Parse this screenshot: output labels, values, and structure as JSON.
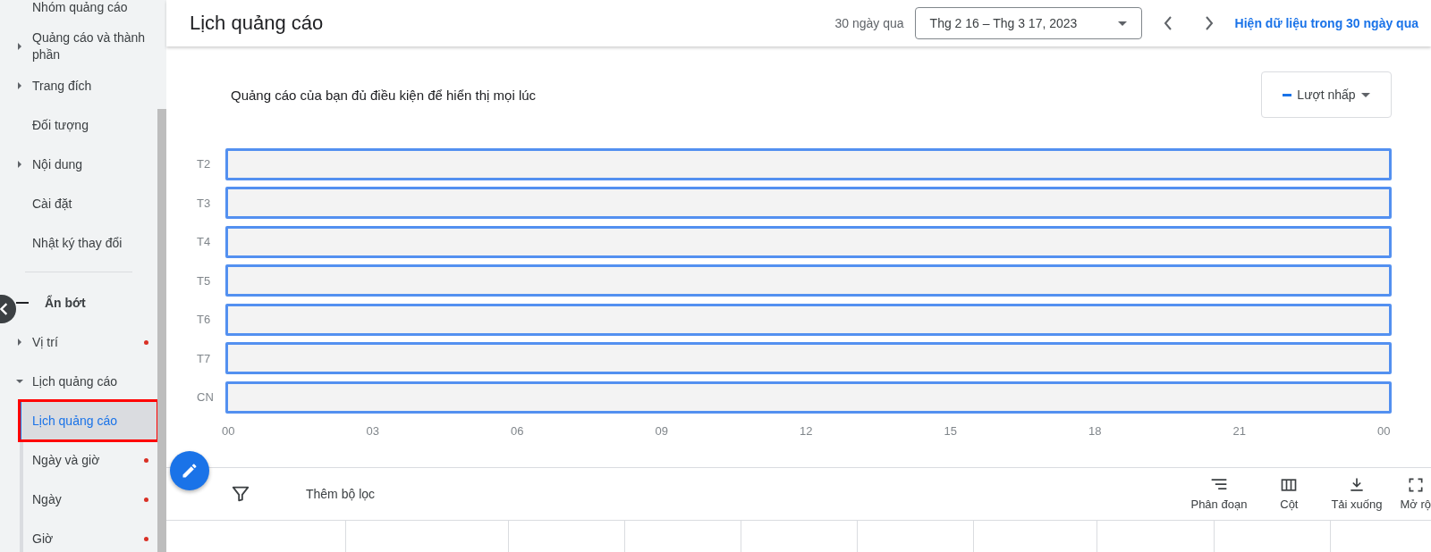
{
  "sidebar": {
    "items": [
      {
        "label": "Nhóm quảng cáo",
        "kind": "page",
        "flagged": false
      },
      {
        "label": "Quảng cáo và thành phần",
        "kind": "group",
        "expanded": false,
        "flagged": false
      },
      {
        "label": "Trang đích",
        "kind": "group",
        "expanded": false,
        "flagged": false
      },
      {
        "label": "Đối tượng",
        "kind": "page",
        "flagged": false
      },
      {
        "label": "Nội dung",
        "kind": "group",
        "expanded": false,
        "flagged": false
      },
      {
        "label": "Cài đặt",
        "kind": "page",
        "flagged": false
      },
      {
        "label": "Nhật ký thay đổi",
        "kind": "page",
        "flagged": false
      },
      {
        "label": "Ẩn bớt",
        "kind": "toggle",
        "flagged": false
      },
      {
        "label": "Vị trí",
        "kind": "group",
        "expanded": false,
        "flagged": true
      },
      {
        "label": "Lịch quảng cáo",
        "kind": "group",
        "expanded": true,
        "flagged": false,
        "children": [
          {
            "label": "Lịch quảng cáo",
            "selected": true,
            "flagged": false,
            "outlined": true
          },
          {
            "label": "Ngày và giờ",
            "selected": false,
            "flagged": true,
            "outlined": false
          },
          {
            "label": "Ngày",
            "selected": false,
            "flagged": true,
            "outlined": false
          },
          {
            "label": "Giờ",
            "selected": false,
            "flagged": true,
            "outlined": false
          }
        ]
      }
    ]
  },
  "header": {
    "title": "Lịch quảng cáo",
    "range_label": "30 ngày qua",
    "date_range": "Thg 2 16 – Thg 3 17, 2023",
    "link": "Hiện dữ liệu trong 30 ngày qua"
  },
  "schedule": {
    "message": "Quảng cáo của bạn đủ điều kiện để hiển thị mọi lúc",
    "metric": "Lượt nhấp",
    "days": [
      "T2",
      "T3",
      "T4",
      "T5",
      "T6",
      "T7",
      "CN"
    ],
    "hours": [
      "00",
      "03",
      "06",
      "09",
      "12",
      "15",
      "18",
      "21",
      "00"
    ]
  },
  "toolbar": {
    "filter": "Thêm bộ lọc",
    "actions": [
      {
        "label": "Phân đoạn",
        "kind": "segment"
      },
      {
        "label": "Cột",
        "kind": "columns"
      },
      {
        "label": "Tải xuống",
        "kind": "download"
      },
      {
        "label": "Mở rộ",
        "kind": "expand"
      }
    ]
  }
}
